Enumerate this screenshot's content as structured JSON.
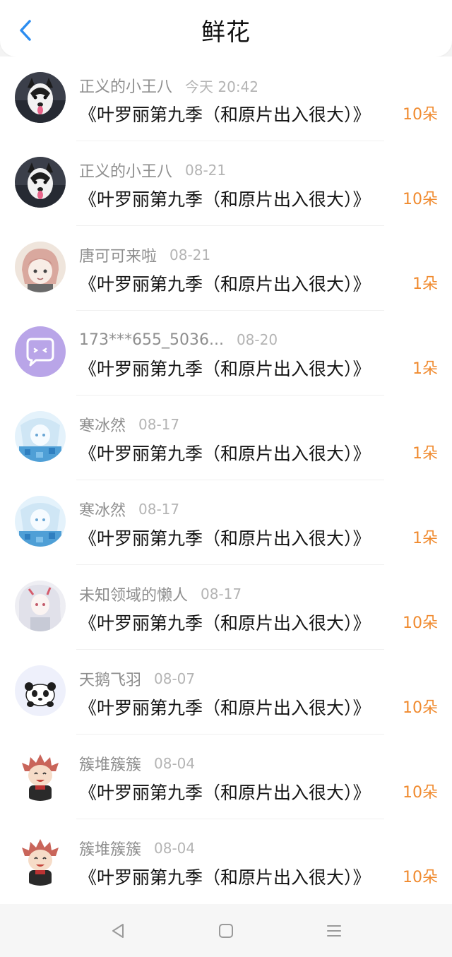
{
  "header": {
    "title": "鲜花",
    "back_icon": "chevron-left-icon",
    "accent": "#2c8df0"
  },
  "items": [
    {
      "name": "正义的小王八",
      "date": "今天 20:42",
      "text": "《叶罗丽第九季（和原片出入很大）》",
      "amount": "10朵",
      "avatar": "husky-avatar"
    },
    {
      "name": "正义的小王八",
      "date": "08-21",
      "text": "《叶罗丽第九季（和原片出入很大）》",
      "amount": "10朵",
      "avatar": "husky-avatar"
    },
    {
      "name": "唐可可来啦",
      "date": "08-21",
      "text": "《叶罗丽第九季（和原片出入很大）》",
      "amount": "1朵",
      "avatar": "anime-girl-avatar"
    },
    {
      "name": "173***655_5036...",
      "date": "08-20",
      "text": "《叶罗丽第九季（和原片出入很大）》",
      "amount": "1朵",
      "avatar": "default-chat-avatar"
    },
    {
      "name": "寒冰然",
      "date": "08-17",
      "text": "《叶罗丽第九季（和原片出入很大）》",
      "amount": "1朵",
      "avatar": "ice-anime-avatar"
    },
    {
      "name": "寒冰然",
      "date": "08-17",
      "text": "《叶罗丽第九季（和原片出入很大）》",
      "amount": "1朵",
      "avatar": "ice-anime-avatar"
    },
    {
      "name": "未知领域的懒人",
      "date": "08-17",
      "text": "《叶罗丽第九季（和原片出入很大）》",
      "amount": "10朵",
      "avatar": "white-hair-anime-avatar"
    },
    {
      "name": "天鹅飞羽",
      "date": "08-07",
      "text": "《叶罗丽第九季（和原片出入很大）》",
      "amount": "10朵",
      "avatar": "panda-avatar"
    },
    {
      "name": "簇堆簇簇",
      "date": "08-04",
      "text": "《叶罗丽第九季（和原片出入很大）》",
      "amount": "10朵",
      "avatar": "chibi-boy-avatar"
    },
    {
      "name": "簇堆簇簇",
      "date": "08-04",
      "text": "《叶罗丽第九季（和原片出入很大）》",
      "amount": "10朵",
      "avatar": "chibi-boy-avatar"
    }
  ],
  "colors": {
    "amount": "#f08a2e",
    "name": "#8e8e8e",
    "date": "#b4b4b4"
  },
  "navbar": {
    "back_icon": "nav-back-icon",
    "home_icon": "nav-home-icon",
    "menu_icon": "nav-menu-icon"
  }
}
